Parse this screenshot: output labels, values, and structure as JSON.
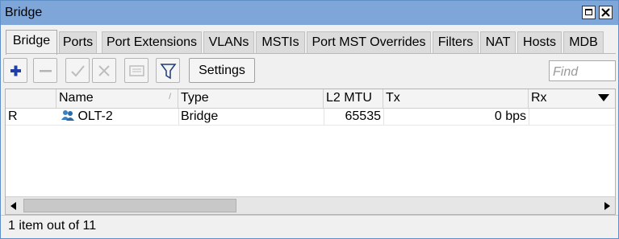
{
  "window": {
    "title": "Bridge"
  },
  "tabs": [
    {
      "label": "Bridge",
      "active": true
    },
    {
      "label": "Ports"
    },
    {
      "label": "Port Extensions"
    },
    {
      "label": "VLANs"
    },
    {
      "label": "MSTIs"
    },
    {
      "label": "Port MST Overrides"
    },
    {
      "label": "Filters"
    },
    {
      "label": "NAT"
    },
    {
      "label": "Hosts"
    },
    {
      "label": "MDB"
    }
  ],
  "toolbar": {
    "add_icon": "plus-icon",
    "remove_icon": "minus-icon",
    "enable_icon": "check-icon",
    "disable_icon": "x-icon",
    "comment_icon": "comment-icon",
    "filter_icon": "funnel-icon",
    "settings_label": "Settings",
    "find_placeholder": "Find"
  },
  "table": {
    "columns": [
      "",
      "Name",
      "Type",
      "L2 MTU",
      "Tx",
      "Rx"
    ],
    "rows": [
      {
        "flag": "R",
        "name": "OLT-2",
        "icon": "bridge-icon",
        "type": "Bridge",
        "l2mtu": "65535",
        "tx": "0 bps",
        "rx": ""
      }
    ]
  },
  "status": {
    "text": "1 item out of 11"
  },
  "colors": {
    "title_bar": "#7ea6d9",
    "add_icon": "#1f3ea8"
  }
}
